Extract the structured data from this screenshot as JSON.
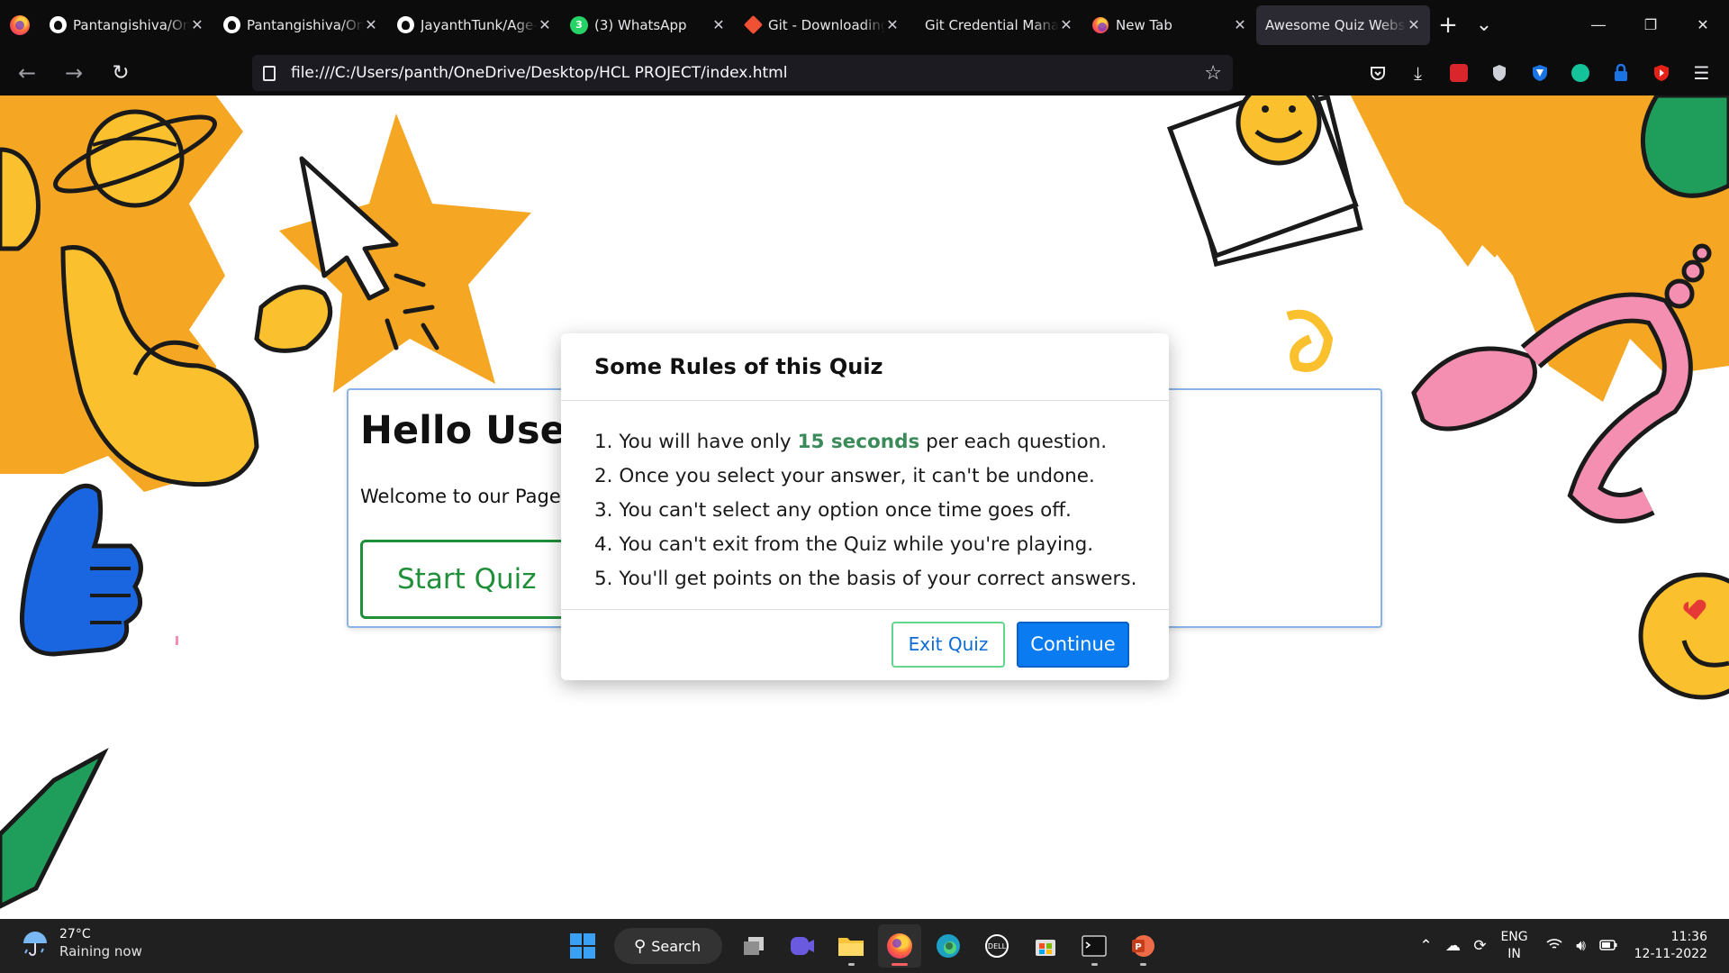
{
  "browser": {
    "tabs": [
      {
        "title": "Pantangishiva/Online-Quiz",
        "icon": "github-icon",
        "active": false
      },
      {
        "title": "Pantangishiva/Online-Quiz",
        "icon": "github-icon",
        "active": false
      },
      {
        "title": "JayanthTunk/Age-Calculator",
        "icon": "github-icon",
        "active": false
      },
      {
        "title": "(3) WhatsApp",
        "icon": "whatsapp-icon",
        "active": false,
        "badge": "3"
      },
      {
        "title": "Git - Downloading Package",
        "icon": "git-icon",
        "active": false
      },
      {
        "title": "Git Credential Manager",
        "icon": "none",
        "active": false
      },
      {
        "title": "New Tab",
        "icon": "firefox-icon",
        "active": false
      },
      {
        "title": "Awesome Quiz Website",
        "icon": "none",
        "active": true
      }
    ],
    "new_tab_symbol": "+",
    "tab_list_symbol": "⌄",
    "url": "file:///C:/Users/panth/OneDrive/Desktop/HCL PROJECT/index.html"
  },
  "page": {
    "hello_title": "Hello User",
    "welcome_text": "Welcome to our Page!",
    "start_button_label": "Start Quiz"
  },
  "modal": {
    "title": "Some Rules of this Quiz",
    "rules": [
      {
        "prefix": "1. You will have only ",
        "highlight": "15 seconds",
        "suffix": " per each question."
      },
      {
        "text": "2. Once you select your answer, it can't be undone."
      },
      {
        "text": "3. You can't select any option once time goes off."
      },
      {
        "text": "4. You can't exit from the Quiz while you're playing."
      },
      {
        "text": "5. You'll get points on the basis of your correct answers."
      }
    ],
    "exit_label": "Exit Quiz",
    "continue_label": "Continue"
  },
  "taskbar": {
    "weather_temp": "27°C",
    "weather_desc": "Raining now",
    "search_label": "Search",
    "lang_top": "ENG",
    "lang_bottom": "IN",
    "time": "11:36",
    "date": "12-11-2022"
  },
  "colors": {
    "accent_green": "#1f8f3a",
    "highlight_green": "#3a8a5a",
    "continue_blue": "#0a7bf0",
    "doodle_orange": "#f5a623",
    "doodle_yellow": "#fbc02d",
    "doodle_pink": "#f48fb1",
    "doodle_blue": "#1a66e0",
    "doodle_green": "#1e9e5a"
  }
}
